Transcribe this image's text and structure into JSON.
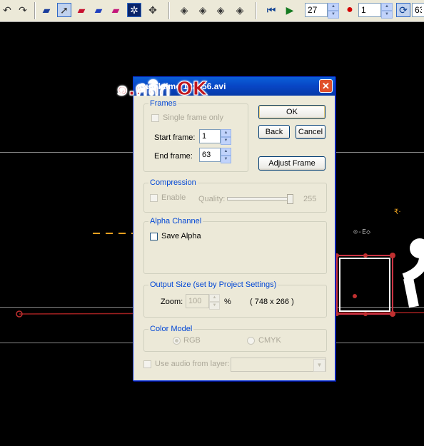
{
  "toolbar": {
    "frame_value": "27",
    "record_value": "1",
    "loop_value": "63",
    "icons": [
      "undo-icon",
      "redo-icon",
      "book-icon",
      "select-arrow-icon",
      "red-bone-icon",
      "blue-layer-icon",
      "pink-layer-icon",
      "skeleton-icon",
      "translate-icon",
      "rewind-icon",
      "forward-step-icon",
      "rotate-icon",
      "advance-icon",
      "first-frame-icon",
      "play-icon",
      "record-icon",
      "loop-icon"
    ]
  },
  "dialog": {
    "title": "Quicktime 123456.avi",
    "title_tail": "456.avi",
    "frames": {
      "group_label": "Frames",
      "single_frame_label": "Single frame only",
      "start_label": "Start frame:",
      "start_value": "1",
      "end_label": "End frame:",
      "end_value": "63"
    },
    "buttons": {
      "ok": "OK",
      "back": "Back",
      "cancel": "Cancel",
      "adjust_frame": "Adjust Frame"
    },
    "compression": {
      "group_label": "Compression",
      "enable_label": "Enable",
      "quality_label": "Quality:",
      "quality_value": "255"
    },
    "alpha": {
      "group_label": "Alpha Channel",
      "save_alpha_label": "Save Alpha"
    },
    "output": {
      "group_label": "Output Size  (set by Project Settings)",
      "zoom_label": "Zoom:",
      "zoom_value": "100",
      "percent": "%",
      "dims": "( 748 x 266 )"
    },
    "color_model": {
      "group_label": "Color Model",
      "rgb": "RGB",
      "cmyk": "CMYK"
    },
    "audio": {
      "label": "Use audio from layer:"
    }
  },
  "annotation": {
    "text": "๑.คลิก OK"
  },
  "colors": {
    "accent_red": "#c0161d",
    "title_blue": "#0845c4",
    "group_label_blue": "#0046d5"
  }
}
